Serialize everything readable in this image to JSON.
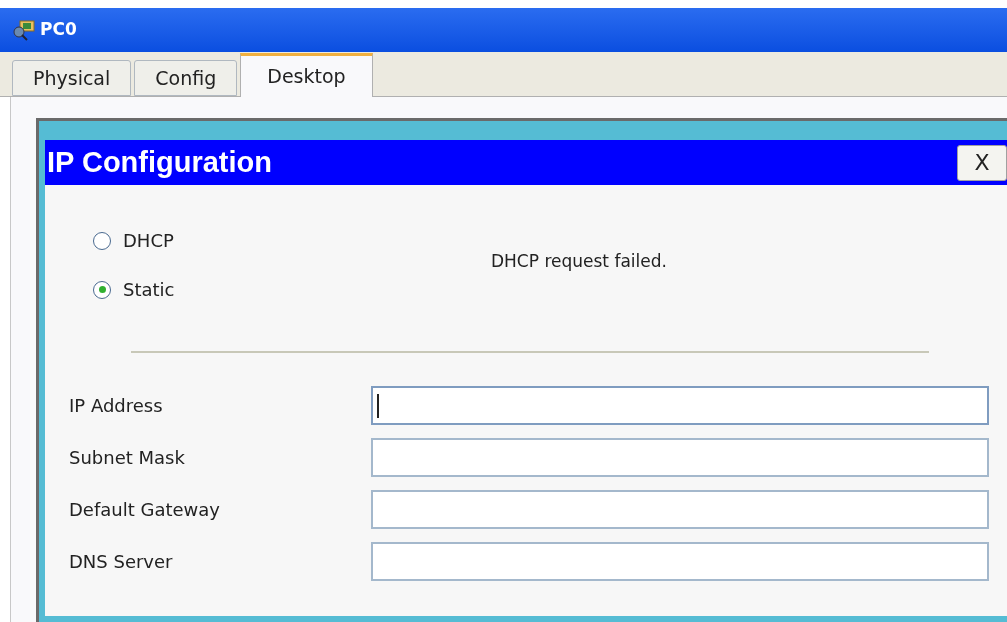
{
  "window": {
    "title": "PC0"
  },
  "tabs": [
    {
      "label": "Physical",
      "selected": false
    },
    {
      "label": "Config",
      "selected": false
    },
    {
      "label": "Desktop",
      "selected": true
    }
  ],
  "dialog": {
    "title": "IP Configuration",
    "close": "X",
    "modes": [
      {
        "label": "DHCP",
        "selected": false
      },
      {
        "label": "Static",
        "selected": true
      }
    ],
    "message": "DHCP request failed.",
    "fields": [
      {
        "label": "IP Address",
        "focused": true
      },
      {
        "label": "Subnet Mask",
        "focused": false
      },
      {
        "label": "Default Gateway",
        "focused": false
      },
      {
        "label": "DNS Server",
        "focused": false
      }
    ]
  }
}
